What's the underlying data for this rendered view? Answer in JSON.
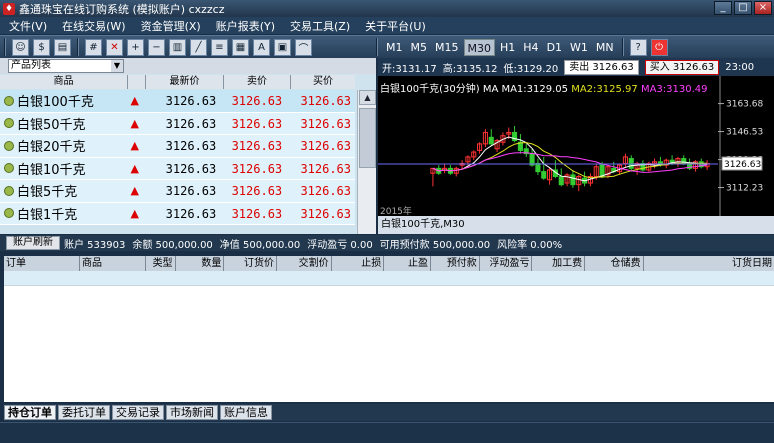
{
  "window": {
    "title": "鑫通珠宝在线订购系统 (模拟账户) cxzzcz",
    "min": "_",
    "max": "□",
    "close": "×"
  },
  "menu": [
    "文件(V)",
    "在线交易(W)",
    "资金管理(X)",
    "账户报表(Y)",
    "交易工具(Z)",
    "关于平台(U)"
  ],
  "toolbar_icons": [
    "users-icon",
    "coin-icon",
    "document-icon",
    "grid-icon",
    "delete-icon",
    "zoom-in-icon",
    "zoom-out-icon",
    "chart-icon",
    "ruler-icon",
    "price-icon",
    "table-icon",
    "font-icon",
    "calendar-icon",
    "trend-icon"
  ],
  "periods": [
    "M1",
    "M5",
    "M15",
    "M30",
    "H1",
    "H4",
    "D1",
    "W1",
    "MN"
  ],
  "active_period": "M30",
  "product_list": {
    "select_label": "产品列表",
    "headers": [
      "商品",
      "最新价",
      "卖价",
      "买价"
    ],
    "rows": [
      {
        "name": "白银100千克",
        "direction": "▲",
        "last": "3126.63",
        "sell": "3126.63",
        "buy": "3126.63"
      },
      {
        "name": "白银50千克",
        "direction": "▲",
        "last": "3126.63",
        "sell": "3126.63",
        "buy": "3126.63"
      },
      {
        "name": "白银20千克",
        "direction": "▲",
        "last": "3126.63",
        "sell": "3126.63",
        "buy": "3126.63"
      },
      {
        "name": "白银10千克",
        "direction": "▲",
        "last": "3126.63",
        "sell": "3126.63",
        "buy": "3126.63"
      },
      {
        "name": "白银5千克",
        "direction": "▲",
        "last": "3126.63",
        "sell": "3126.63",
        "buy": "3126.63"
      },
      {
        "name": "白银1千克",
        "direction": "▲",
        "last": "3126.63",
        "sell": "3126.63",
        "buy": "3126.63"
      }
    ]
  },
  "quote": {
    "open": "开:3131.17",
    "high": "高:3135.12",
    "low": "低:3129.20",
    "sell_btn": "卖出 3126.63",
    "buy_btn": "买入 3126.63",
    "time": "23:00"
  },
  "chart": {
    "symbol": "白银100千克(30分钟)",
    "ma1": "MA MA1:3129.05",
    "ma2": "MA2:3125.97",
    "ma3": "MA3:3130.49",
    "year": "2015年",
    "footer": "白银100千克,M30",
    "colors": {
      "up": "#ff3333",
      "down": "#33cc33",
      "ma1": "#ffffff",
      "ma2": "#e0e020",
      "ma3": "#ff40ff",
      "price": "#6a6aff"
    }
  },
  "chart_data": {
    "type": "candlestick",
    "y_ticks": [
      "3163.68",
      "3146.53",
      "3129.38",
      "3112.23"
    ],
    "current_price": "3126.63",
    "ylim": [
      3104,
      3172
    ],
    "candles": [
      [
        3121,
        3124,
        3113,
        3124
      ],
      [
        3124,
        3126,
        3120,
        3121
      ],
      [
        3123,
        3127,
        3121,
        3124
      ],
      [
        3124,
        3126,
        3120,
        3121
      ],
      [
        3121,
        3125,
        3119,
        3124
      ],
      [
        3126,
        3129,
        3123,
        3127
      ],
      [
        3128,
        3132,
        3126,
        3131
      ],
      [
        3131,
        3135,
        3129,
        3134
      ],
      [
        3135,
        3140,
        3133,
        3139
      ],
      [
        3139,
        3148,
        3137,
        3146
      ],
      [
        3143,
        3148,
        3138,
        3139
      ],
      [
        3136,
        3142,
        3134,
        3141
      ],
      [
        3140,
        3146,
        3138,
        3144
      ],
      [
        3145,
        3149,
        3142,
        3146
      ],
      [
        3146,
        3150,
        3140,
        3141
      ],
      [
        3140,
        3145,
        3133,
        3135
      ],
      [
        3136,
        3139,
        3131,
        3133
      ],
      [
        3133,
        3136,
        3125,
        3126
      ],
      [
        3127,
        3130,
        3120,
        3122
      ],
      [
        3122,
        3131,
        3117,
        3118
      ],
      [
        3117,
        3124,
        3114,
        3123
      ],
      [
        3123,
        3129,
        3118,
        3119
      ],
      [
        3119,
        3124,
        3113,
        3114
      ],
      [
        3115,
        3121,
        3113,
        3120
      ],
      [
        3120,
        3123,
        3112,
        3114
      ],
      [
        3114,
        3120,
        3110,
        3119
      ],
      [
        3118,
        3122,
        3113,
        3115
      ],
      [
        3115,
        3121,
        3113,
        3119
      ],
      [
        3119,
        3127,
        3117,
        3125
      ],
      [
        3126,
        3128,
        3118,
        3119
      ],
      [
        3120,
        3126,
        3118,
        3125
      ],
      [
        3124,
        3128,
        3121,
        3122
      ],
      [
        3122,
        3127,
        3120,
        3126
      ],
      [
        3127,
        3133,
        3125,
        3131
      ],
      [
        3130,
        3132,
        3122,
        3124
      ],
      [
        3124,
        3128,
        3120,
        3127
      ],
      [
        3127,
        3129,
        3122,
        3123
      ],
      [
        3123,
        3128,
        3122,
        3127
      ],
      [
        3127,
        3130,
        3124,
        3128
      ],
      [
        3128,
        3131,
        3125,
        3126
      ],
      [
        3126,
        3130,
        3124,
        3129
      ],
      [
        3129,
        3132,
        3126,
        3127
      ],
      [
        3127,
        3131,
        3125,
        3130
      ],
      [
        3130,
        3132,
        3126,
        3127
      ],
      [
        3127,
        3130,
        3123,
        3124
      ],
      [
        3124,
        3129,
        3122,
        3128
      ],
      [
        3128,
        3130,
        3124,
        3125
      ],
      [
        3125,
        3129,
        3123,
        3127
      ]
    ]
  },
  "account": {
    "refresh": "账户刷新",
    "acct": "账户 533903",
    "balance": "余额 500,000.00",
    "equity": "净值 500,000.00",
    "pnl": "浮动盈亏 0.00",
    "margin": "可用预付款 500,000.00",
    "risk": "风险率 0.00%"
  },
  "orders": {
    "headers": [
      "订单",
      "商品",
      "类型",
      "数量",
      "订货价",
      "交割价",
      "止损",
      "止盈",
      "预付款",
      "浮动盈亏",
      "加工费",
      "仓储费",
      "订货日期"
    ]
  },
  "tabs": [
    "持仓订单",
    "委托订单",
    "交易记录",
    "市场新闻",
    "账户信息"
  ]
}
